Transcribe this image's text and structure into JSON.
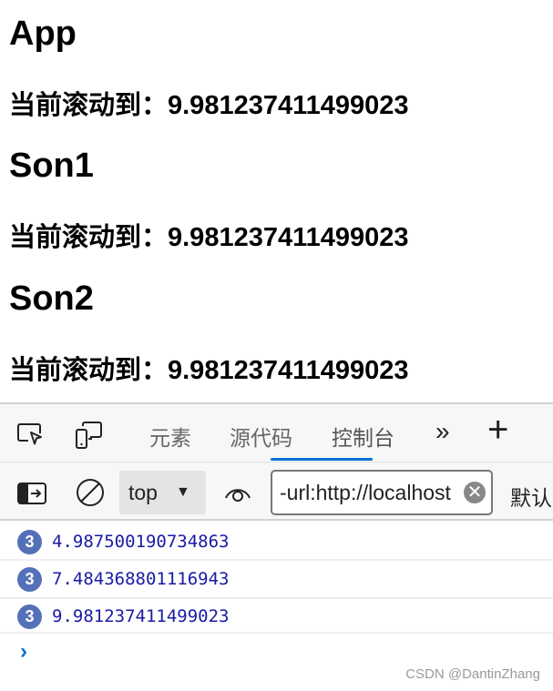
{
  "page": {
    "sections": [
      {
        "title": "App",
        "scroll_text": "当前滚动到：9.981237411499023"
      },
      {
        "title": "Son1",
        "scroll_text": "当前滚动到：9.981237411499023"
      },
      {
        "title": "Son2",
        "scroll_text": "当前滚动到：9.981237411499023"
      }
    ]
  },
  "devtools": {
    "tabs": [
      {
        "label": "元素",
        "active": false
      },
      {
        "label": "源代码",
        "active": false
      },
      {
        "label": "控制台",
        "active": true
      }
    ],
    "more_label": "»",
    "add_label": "+",
    "context": "top",
    "filter_value": "-url:http://localhost",
    "levels_label": "默认",
    "accent": "#0a6fd4",
    "console_rows": [
      {
        "count": "3",
        "value": "4.987500190734863"
      },
      {
        "count": "3",
        "value": "7.484368801116943"
      },
      {
        "count": "3",
        "value": "9.981237411499023"
      }
    ],
    "prompt": "›"
  },
  "watermark": "CSDN @DantinZhang"
}
